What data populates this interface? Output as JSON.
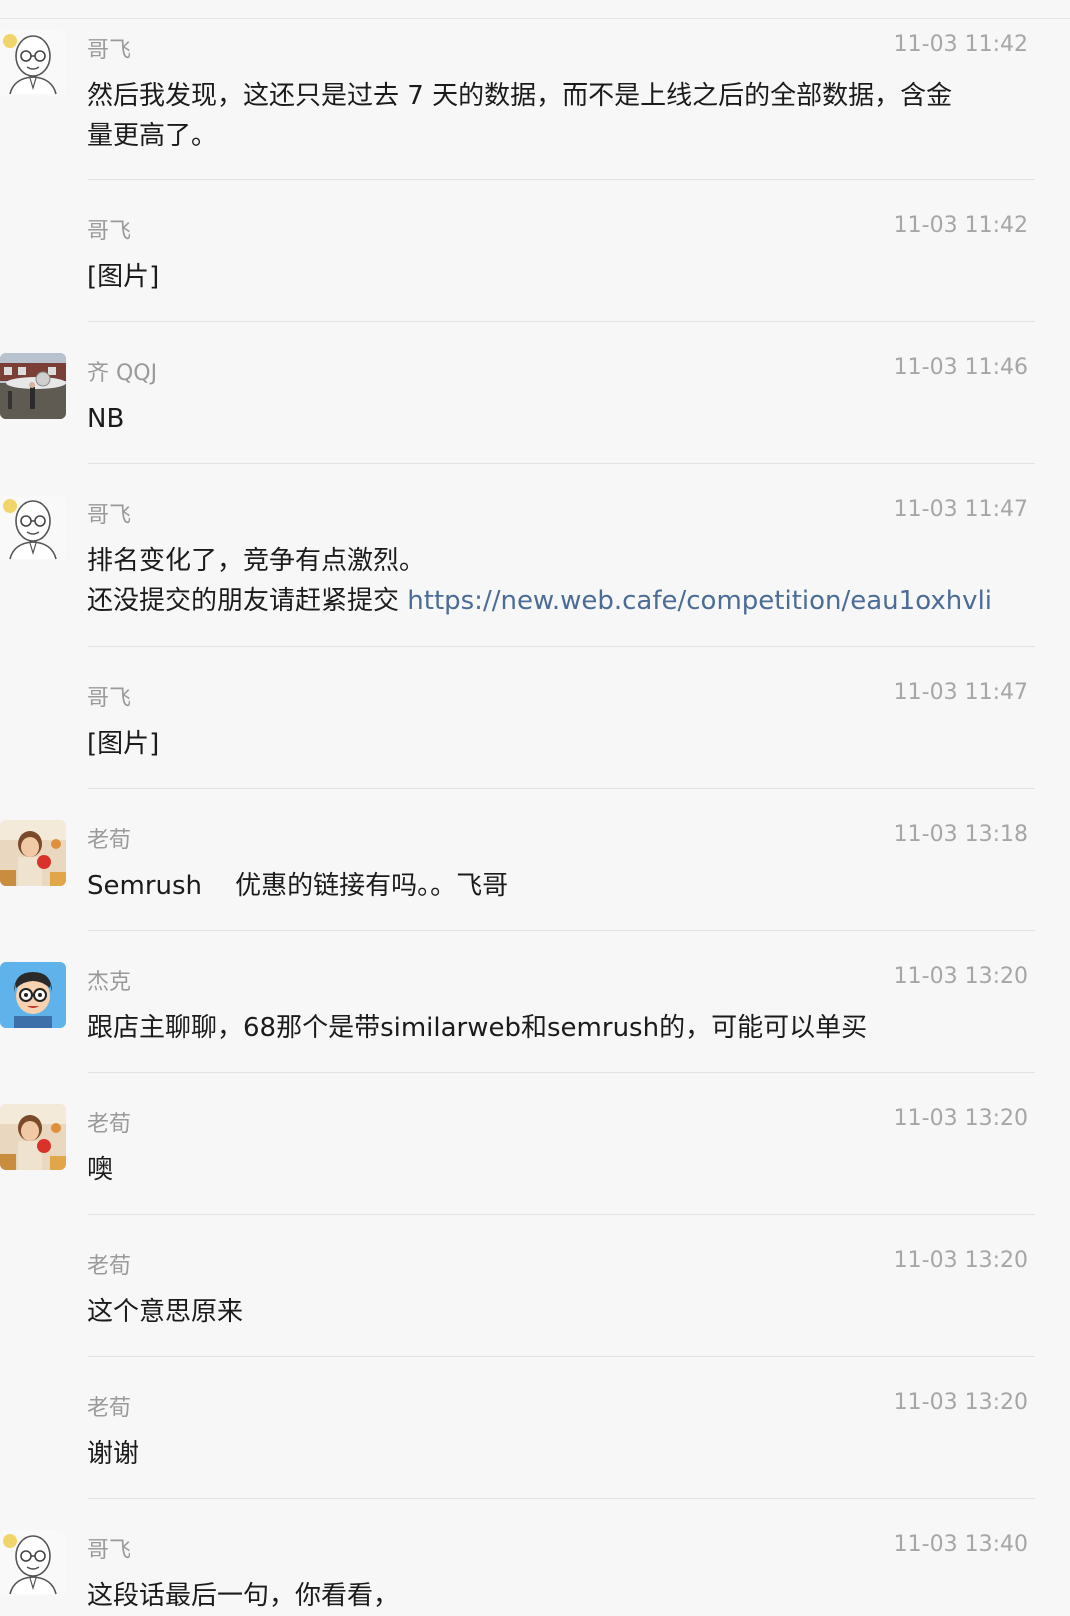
{
  "messages": [
    {
      "sender": "哥飞",
      "time": "11-03 11:42",
      "avatar": "bald-glasses-man-avatar",
      "lines": [
        "然后我发现，这还只是过去 7 天的数据，而不是上线之后的全部数据，含金",
        "量更高了。"
      ]
    },
    {
      "sender": "哥飞",
      "time": "11-03 11:42",
      "avatar": null,
      "lines": [
        "[图片]"
      ]
    },
    {
      "sender": "齐 QQJ",
      "time": "11-03 11:46",
      "avatar": "airplane-photo-avatar",
      "lines": [
        "NB"
      ]
    },
    {
      "sender": "哥飞",
      "time": "11-03 11:47",
      "avatar": "bald-glasses-man-avatar",
      "lines": [
        "排名变化了，竞争有点激烈。",
        "还没提交的朋友请赶紧提交 "
      ],
      "link": "https://new.web.cafe/competition/eau1oxhvli"
    },
    {
      "sender": "哥飞",
      "time": "11-03 11:47",
      "avatar": null,
      "lines": [
        "[图片]"
      ]
    },
    {
      "sender": "老荀",
      "time": "11-03 13:18",
      "avatar": "girl-photo-avatar",
      "lines": [
        "Semrush    优惠的链接有吗。。飞哥"
      ]
    },
    {
      "sender": "杰克",
      "time": "11-03 13:20",
      "avatar": "cartoon-boy-avatar",
      "lines": [
        "跟店主聊聊，68那个是带similarweb和semrush的，可能可以单买"
      ]
    },
    {
      "sender": "老荀",
      "time": "11-03 13:20",
      "avatar": "girl-photo-avatar",
      "lines": [
        "噢"
      ]
    },
    {
      "sender": "老荀",
      "time": "11-03 13:20",
      "avatar": null,
      "lines": [
        "这个意思原来"
      ]
    },
    {
      "sender": "老荀",
      "time": "11-03 13:20",
      "avatar": null,
      "lines": [
        "谢谢"
      ]
    },
    {
      "sender": "哥飞",
      "time": "11-03 13:40",
      "avatar": "bald-glasses-man-avatar",
      "lines": [
        "这段话最后一句，你看看，"
      ]
    }
  ],
  "colors": {
    "background": "#f7f7f7",
    "text": "#1b1b1b",
    "meta": "#9a9a9a",
    "link": "#4a6c96",
    "divider": "#e2e2e2"
  }
}
